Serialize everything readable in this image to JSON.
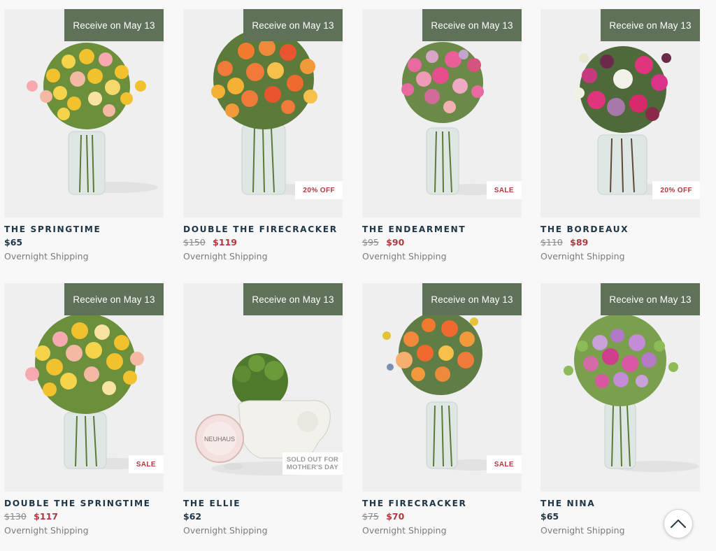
{
  "products": [
    {
      "name": "THE SPRINGTIME",
      "price": "$65",
      "old_price": "",
      "sale_price": "",
      "shipping": "Overnight Shipping",
      "delivery": "Receive on May 13",
      "tag": "",
      "art": "yellow-roses"
    },
    {
      "name": "DOUBLE THE FIRECRACKER",
      "price": "",
      "old_price": "$150",
      "sale_price": "$119",
      "shipping": "Overnight Shipping",
      "delivery": "Receive on May 13",
      "tag": "20% OFF",
      "art": "orange-roses"
    },
    {
      "name": "THE ENDEARMENT",
      "price": "",
      "old_price": "$95",
      "sale_price": "$90",
      "shipping": "Overnight Shipping",
      "delivery": "Receive on May 13",
      "tag": "SALE",
      "art": "pink-roses"
    },
    {
      "name": "THE BORDEAUX",
      "price": "",
      "old_price": "$110",
      "sale_price": "$89",
      "shipping": "Overnight Shipping",
      "delivery": "Receive on May 13",
      "tag": "20% OFF",
      "art": "magenta-roses"
    },
    {
      "name": "DOUBLE THE SPRINGTIME",
      "price": "",
      "old_price": "$130",
      "sale_price": "$117",
      "shipping": "Overnight Shipping",
      "delivery": "Receive on May 13",
      "tag": "SALE",
      "art": "yellow-roses-large"
    },
    {
      "name": "THE ELLIE",
      "price": "$62",
      "old_price": "",
      "sale_price": "",
      "shipping": "Overnight Shipping",
      "delivery": "Receive on May 13",
      "tag": "SOLD OUT FOR\nMOTHER'S DAY",
      "art": "succulent-elephant"
    },
    {
      "name": "THE FIRECRACKER",
      "price": "",
      "old_price": "$75",
      "sale_price": "$70",
      "shipping": "Overnight Shipping",
      "delivery": "Receive on May 13",
      "tag": "SALE",
      "art": "orange-bouquet"
    },
    {
      "name": "THE NINA",
      "price": "$65",
      "old_price": "",
      "sale_price": "",
      "shipping": "Overnight Shipping",
      "delivery": "Receive on May 13",
      "tag": "",
      "art": "purple-roses"
    }
  ],
  "ellie_box_label": "NEUHAUS",
  "scroll_top_icon": "chevron-up-icon",
  "colors": {
    "delivery_pill": "#5f7158",
    "sale": "#b0393d",
    "title": "#1f3647"
  }
}
